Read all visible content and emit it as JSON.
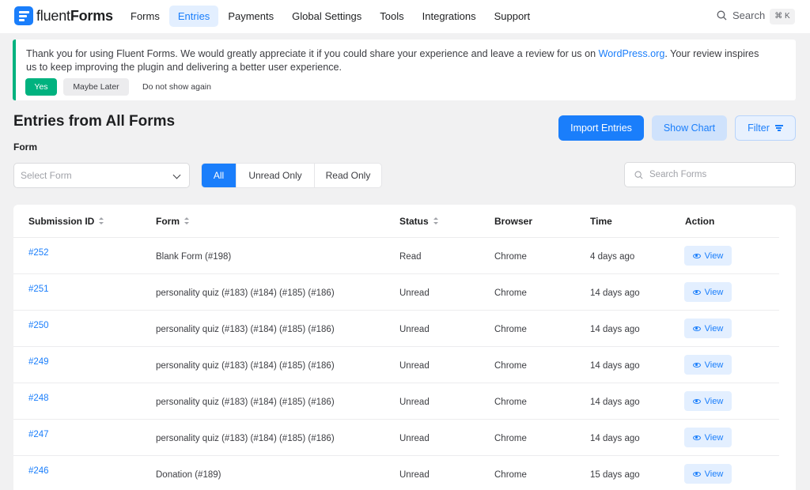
{
  "nav": {
    "logo_prefix": "fluent",
    "logo_suffix": "Forms",
    "items": [
      {
        "label": "Forms",
        "active": false
      },
      {
        "label": "Entries",
        "active": true
      },
      {
        "label": "Payments",
        "active": false
      },
      {
        "label": "Global Settings",
        "active": false
      },
      {
        "label": "Tools",
        "active": false
      },
      {
        "label": "Integrations",
        "active": false
      },
      {
        "label": "Support",
        "active": false
      }
    ],
    "search_label": "Search",
    "search_shortcut": "⌘ K"
  },
  "notice": {
    "text_before_link": "Thank you for using Fluent Forms. We would greatly appreciate it if you could share your experience and leave a review for us on ",
    "link_text": "WordPress.org",
    "text_after_link": ". Your review inspires us to keep improving the plugin and delivering a better user experience.",
    "yes_label": "Yes",
    "later_label": "Maybe Later",
    "dont_show_label": "Do not show again"
  },
  "page": {
    "title": "Entries from All Forms",
    "import_label": "Import Entries",
    "chart_label": "Show Chart",
    "filter_label": "Filter",
    "form_label": "Form",
    "select_placeholder": "Select Form",
    "status_tabs": [
      {
        "label": "All",
        "active": true
      },
      {
        "label": "Unread Only",
        "active": false
      },
      {
        "label": "Read Only",
        "active": false
      }
    ],
    "search_placeholder": "Search Forms"
  },
  "table": {
    "columns": [
      "Submission ID",
      "Form",
      "Status",
      "Browser",
      "Time",
      "Action"
    ],
    "view_label": "View",
    "rows": [
      {
        "id": "#252",
        "form": "Blank Form (#198)",
        "status": "Read",
        "browser": "Chrome",
        "time": "4 days ago"
      },
      {
        "id": "#251",
        "form": "personality quiz (#183) (#184) (#185) (#186)",
        "status": "Unread",
        "browser": "Chrome",
        "time": "14 days ago"
      },
      {
        "id": "#250",
        "form": "personality quiz (#183) (#184) (#185) (#186)",
        "status": "Unread",
        "browser": "Chrome",
        "time": "14 days ago"
      },
      {
        "id": "#249",
        "form": "personality quiz (#183) (#184) (#185) (#186)",
        "status": "Unread",
        "browser": "Chrome",
        "time": "14 days ago"
      },
      {
        "id": "#248",
        "form": "personality quiz (#183) (#184) (#185) (#186)",
        "status": "Unread",
        "browser": "Chrome",
        "time": "14 days ago"
      },
      {
        "id": "#247",
        "form": "personality quiz (#183) (#184) (#185) (#186)",
        "status": "Unread",
        "browser": "Chrome",
        "time": "14 days ago"
      },
      {
        "id": "#246",
        "form": "Donation (#189)",
        "status": "Unread",
        "browser": "Chrome",
        "time": "15 days ago"
      }
    ]
  },
  "colors": {
    "primary": "#1a7efb",
    "success": "#00b27f",
    "background": "#f1f1f2"
  }
}
